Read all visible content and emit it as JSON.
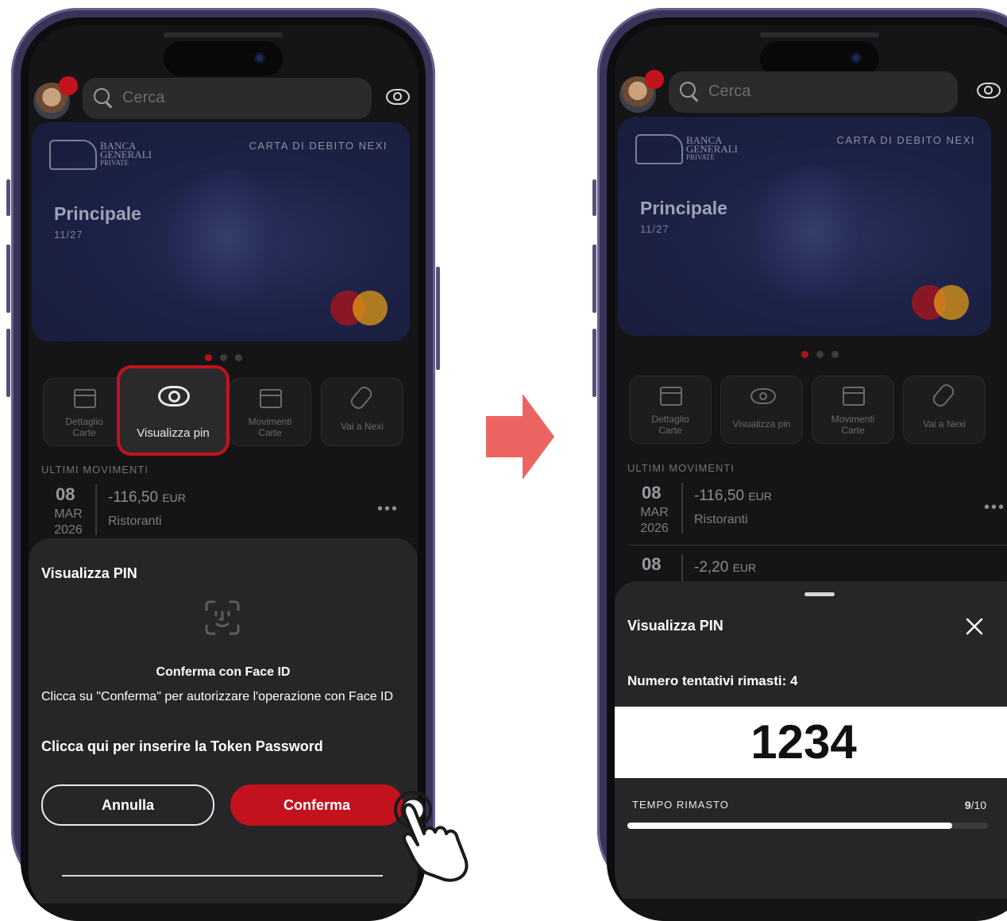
{
  "common": {
    "search_placeholder": "Cerca",
    "card_type": "CARTA DI DEBITO NEXI",
    "bank_line1": "BANCA",
    "bank_line2": "GENERALI",
    "bank_line3": "PRIVATE",
    "card_name": "Principale",
    "card_expiry": "11/27",
    "actions": [
      {
        "label": "Dettaglio\nCarte",
        "icon": "card-icon"
      },
      {
        "label": "Visualizza pin",
        "icon": "eye-icon"
      },
      {
        "label": "Movimenti\nCarte",
        "icon": "card-plus-icon"
      },
      {
        "label": "Vai a Nexi",
        "icon": "link-icon"
      }
    ],
    "section_title": "ULTIMI MOVIMENTI",
    "movements": [
      {
        "day": "08",
        "month": "MAR",
        "year": "2026",
        "amount": "-116,50",
        "currency": "EUR",
        "category": "Ristoranti"
      },
      {
        "day": "08",
        "amount": "-2,20",
        "currency": "EUR"
      }
    ],
    "colors": {
      "accent": "#c3121d",
      "bg": "#151517",
      "sheet": "#262628"
    }
  },
  "left": {
    "highlight_label": "Visualizza pin",
    "sheet_title": "Visualizza PIN",
    "faceid_title": "Conferma con Face ID",
    "faceid_desc": "Clicca su \"Conferma\" per autorizzare l'operazione con Face ID",
    "token_link": "Clicca qui per inserire la Token Password",
    "cancel_label": "Annulla",
    "confirm_label": "Conferma"
  },
  "right": {
    "sheet_title": "Visualizza PIN",
    "attempts": "Numero tentativi rimasti: 4",
    "pin": "1234",
    "time_label": "TEMPO RIMASTO",
    "time_value": "9",
    "time_total": "/10",
    "progress_fraction": 0.9
  }
}
